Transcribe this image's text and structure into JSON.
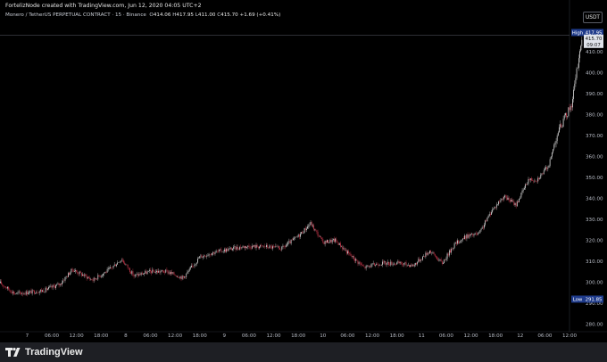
{
  "header": {
    "creator_line": "FortelizNode created with TradingView.com, Jun 12, 2020 04:05 UTC+2"
  },
  "legend": {
    "symbol": "Monero / TetherUS PERPETUAL CONTRACT · 15 · Binance",
    "o_label": "O",
    "o_value": "414.06",
    "h_label": "H",
    "h_value": "417.95",
    "l_label": "L",
    "l_value": "411.00",
    "c_label": "C",
    "c_value": "415.70",
    "change": "+1.69 (+0.41%)"
  },
  "currency_button": "USDT",
  "price_tags": {
    "high_label": "High",
    "high_value": "417.95",
    "last_value": "415.70",
    "countdown": "09:07",
    "low_label": "Low",
    "low_value": "291.85"
  },
  "footer": {
    "brand": "TradingView"
  },
  "colors": {
    "up": "#e8e8e8",
    "down": "#d4394f",
    "tag_bg": "#1e3a8a",
    "last_bg": "#dfe3ea"
  },
  "chart_data": {
    "type": "candlestick",
    "y_ticks": [
      "410.00",
      "400.00",
      "390.00",
      "380.00",
      "370.00",
      "360.00",
      "350.00",
      "340.00",
      "330.00",
      "320.00",
      "310.00",
      "300.00",
      "290.00",
      "280.00"
    ],
    "ylim": [
      278,
      422
    ],
    "x_ticks": [
      "7",
      "06:00",
      "12:00",
      "18:00",
      "8",
      "06:00",
      "12:00",
      "18:00",
      "9",
      "06:00",
      "12:00",
      "18:00",
      "10",
      "06:00",
      "12:00",
      "18:00",
      "11",
      "06:00",
      "12:00",
      "18:00",
      "12",
      "06:00",
      "12:00"
    ],
    "x_range_hours": [
      -6.6,
      132
    ],
    "price_path": [
      {
        "t": -6.5,
        "p": 299.5
      },
      {
        "t": -3,
        "p": 294.5
      },
      {
        "t": 0,
        "p": 295
      },
      {
        "t": 4,
        "p": 296
      },
      {
        "t": 8,
        "p": 299
      },
      {
        "t": 11,
        "p": 306
      },
      {
        "t": 14,
        "p": 303
      },
      {
        "t": 16,
        "p": 301
      },
      {
        "t": 20,
        "p": 306
      },
      {
        "t": 23,
        "p": 311
      },
      {
        "t": 26,
        "p": 303
      },
      {
        "t": 30,
        "p": 305
      },
      {
        "t": 34,
        "p": 305
      },
      {
        "t": 38,
        "p": 302
      },
      {
        "t": 42,
        "p": 312
      },
      {
        "t": 45,
        "p": 314
      },
      {
        "t": 50,
        "p": 316
      },
      {
        "t": 53,
        "p": 317
      },
      {
        "t": 58,
        "p": 317
      },
      {
        "t": 62,
        "p": 316
      },
      {
        "t": 66,
        "p": 322
      },
      {
        "t": 69,
        "p": 328
      },
      {
        "t": 72,
        "p": 319
      },
      {
        "t": 75,
        "p": 320
      },
      {
        "t": 78,
        "p": 314
      },
      {
        "t": 82,
        "p": 307
      },
      {
        "t": 86,
        "p": 309
      },
      {
        "t": 90,
        "p": 309
      },
      {
        "t": 94,
        "p": 308
      },
      {
        "t": 98,
        "p": 315
      },
      {
        "t": 101,
        "p": 309
      },
      {
        "t": 104,
        "p": 318
      },
      {
        "t": 107,
        "p": 322
      },
      {
        "t": 110,
        "p": 323
      },
      {
        "t": 113,
        "p": 334
      },
      {
        "t": 116,
        "p": 341
      },
      {
        "t": 119,
        "p": 337
      },
      {
        "t": 122,
        "p": 349
      },
      {
        "t": 124,
        "p": 349
      },
      {
        "t": 125,
        "p": 351
      },
      {
        "t": 127,
        "p": 356
      },
      {
        "t": 129,
        "p": 371
      },
      {
        "t": 131,
        "p": 379
      },
      {
        "t": 132.5,
        "p": 385
      },
      {
        "t": 133.5,
        "p": 397
      },
      {
        "t": 134.6,
        "p": 412
      },
      {
        "t": 135.2,
        "p": 415.7
      }
    ]
  }
}
